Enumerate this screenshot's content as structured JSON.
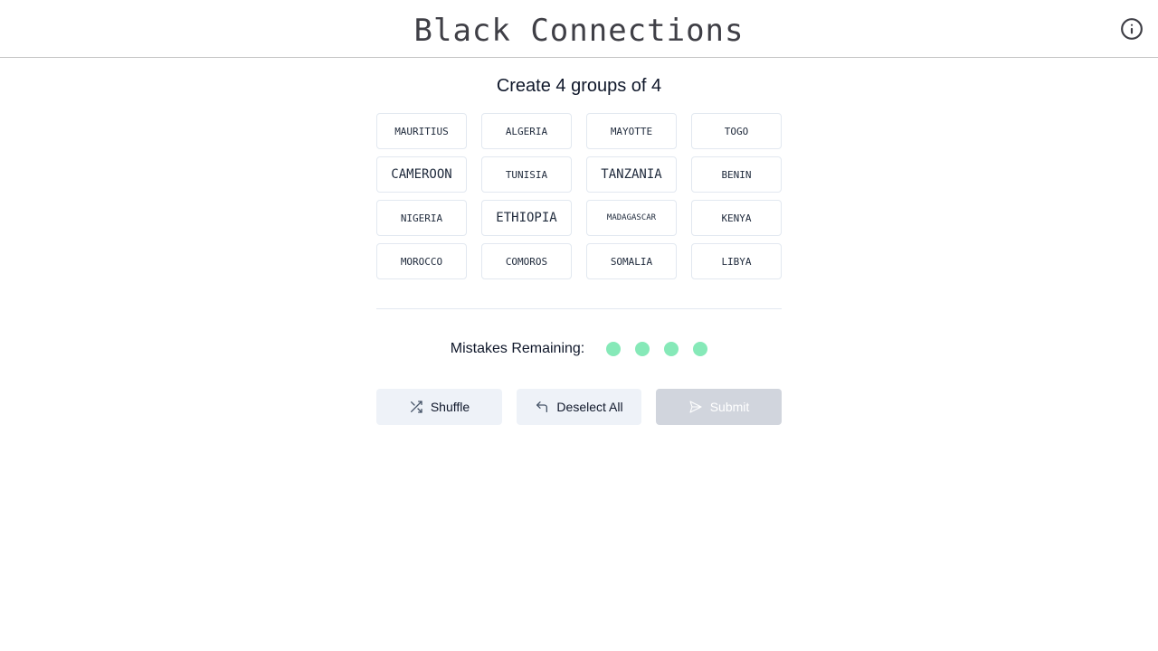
{
  "header": {
    "title": "Black Connections",
    "info_icon": "info-circle-icon"
  },
  "game": {
    "instruction": "Create 4 groups of 4",
    "tiles": [
      "MAURITIUS",
      "ALGERIA",
      "MAYOTTE",
      "TOGO",
      "CAMEROON",
      "TUNISIA",
      "TANZANIA",
      "BENIN",
      "NIGERIA",
      "ETHIOPIA",
      "MADAGASCAR",
      "KENYA",
      "MOROCCO",
      "COMOROS",
      "SOMALIA",
      "LIBYA"
    ],
    "mistakes_label": "Mistakes Remaining:",
    "mistakes_remaining": 4,
    "dot_color": "#86e9b8"
  },
  "actions": {
    "shuffle_label": "Shuffle",
    "shuffle_icon": "shuffle-icon",
    "deselect_label": "Deselect All",
    "deselect_icon": "undo-icon",
    "submit_label": "Submit",
    "submit_icon": "send-icon"
  }
}
